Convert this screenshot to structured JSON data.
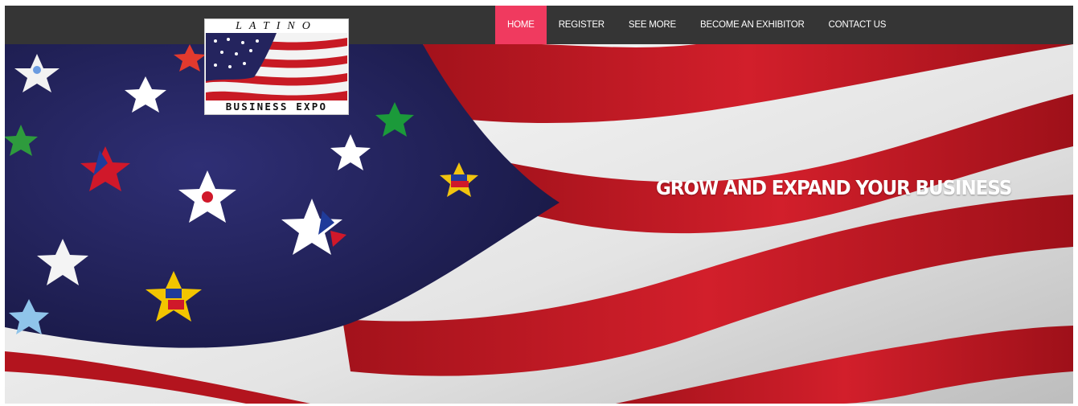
{
  "logo": {
    "top_text": "LATINO",
    "bottom_text": "BUSINESS EXPO"
  },
  "nav": {
    "items": [
      {
        "label": "HOME",
        "active": true
      },
      {
        "label": "REGISTER",
        "active": false
      },
      {
        "label": "SEE MORE",
        "active": false
      },
      {
        "label": "BECOME AN EXHIBITOR",
        "active": false
      },
      {
        "label": "CONTACT US",
        "active": false
      }
    ]
  },
  "hero": {
    "headline": "GROW AND EXPAND YOUR BUSINESS",
    "image": "waving-us-flag-with-latin-american-flag-stars"
  },
  "colors": {
    "navbar": "#353535",
    "active_nav": "#f03a5f",
    "flag_red": "#c81a24",
    "flag_blue": "#24245e",
    "flag_white": "#ececec"
  }
}
